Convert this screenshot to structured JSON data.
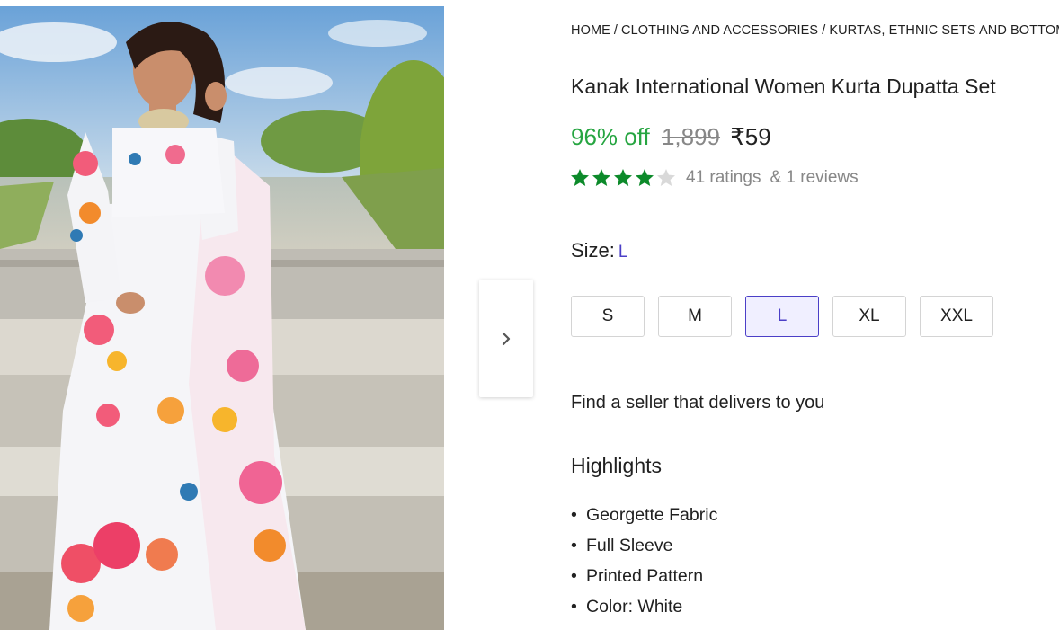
{
  "breadcrumb": {
    "items": [
      "HOME",
      "CLOTHING AND ACCESSORIES",
      "KURTAS, ETHNIC SETS AND BOTTOMS"
    ],
    "separator": "/"
  },
  "product": {
    "title": "Kanak International Women Kurta Dupatta Set",
    "image_alt": "Woman in white floral kurta with dupatta on a bridge",
    "image_icon": "product-photo"
  },
  "pricing": {
    "discount": "96% off",
    "mrp": "1,899",
    "price": "₹59"
  },
  "rating": {
    "stars_filled": 4,
    "stars_total": 5,
    "ratings_text": "41 ratings",
    "reviews_text": "& 1 reviews",
    "star_color": "#0c8a2a",
    "star_empty_color": "#d9d9d9"
  },
  "size": {
    "label": "Size:",
    "selected": "L",
    "options": [
      "S",
      "M",
      "L",
      "XL",
      "XXL"
    ]
  },
  "seller": {
    "text": "Find a seller that delivers to you"
  },
  "highlights": {
    "heading": "Highlights",
    "items": [
      "Georgette Fabric",
      "Full Sleeve",
      "Printed Pattern",
      "Color: White"
    ]
  },
  "navigation": {
    "next_icon": "chevron-right-icon"
  },
  "colors": {
    "discount_green": "#26a541",
    "accent_purple": "#4b3fc7",
    "muted_gray": "#878787"
  }
}
